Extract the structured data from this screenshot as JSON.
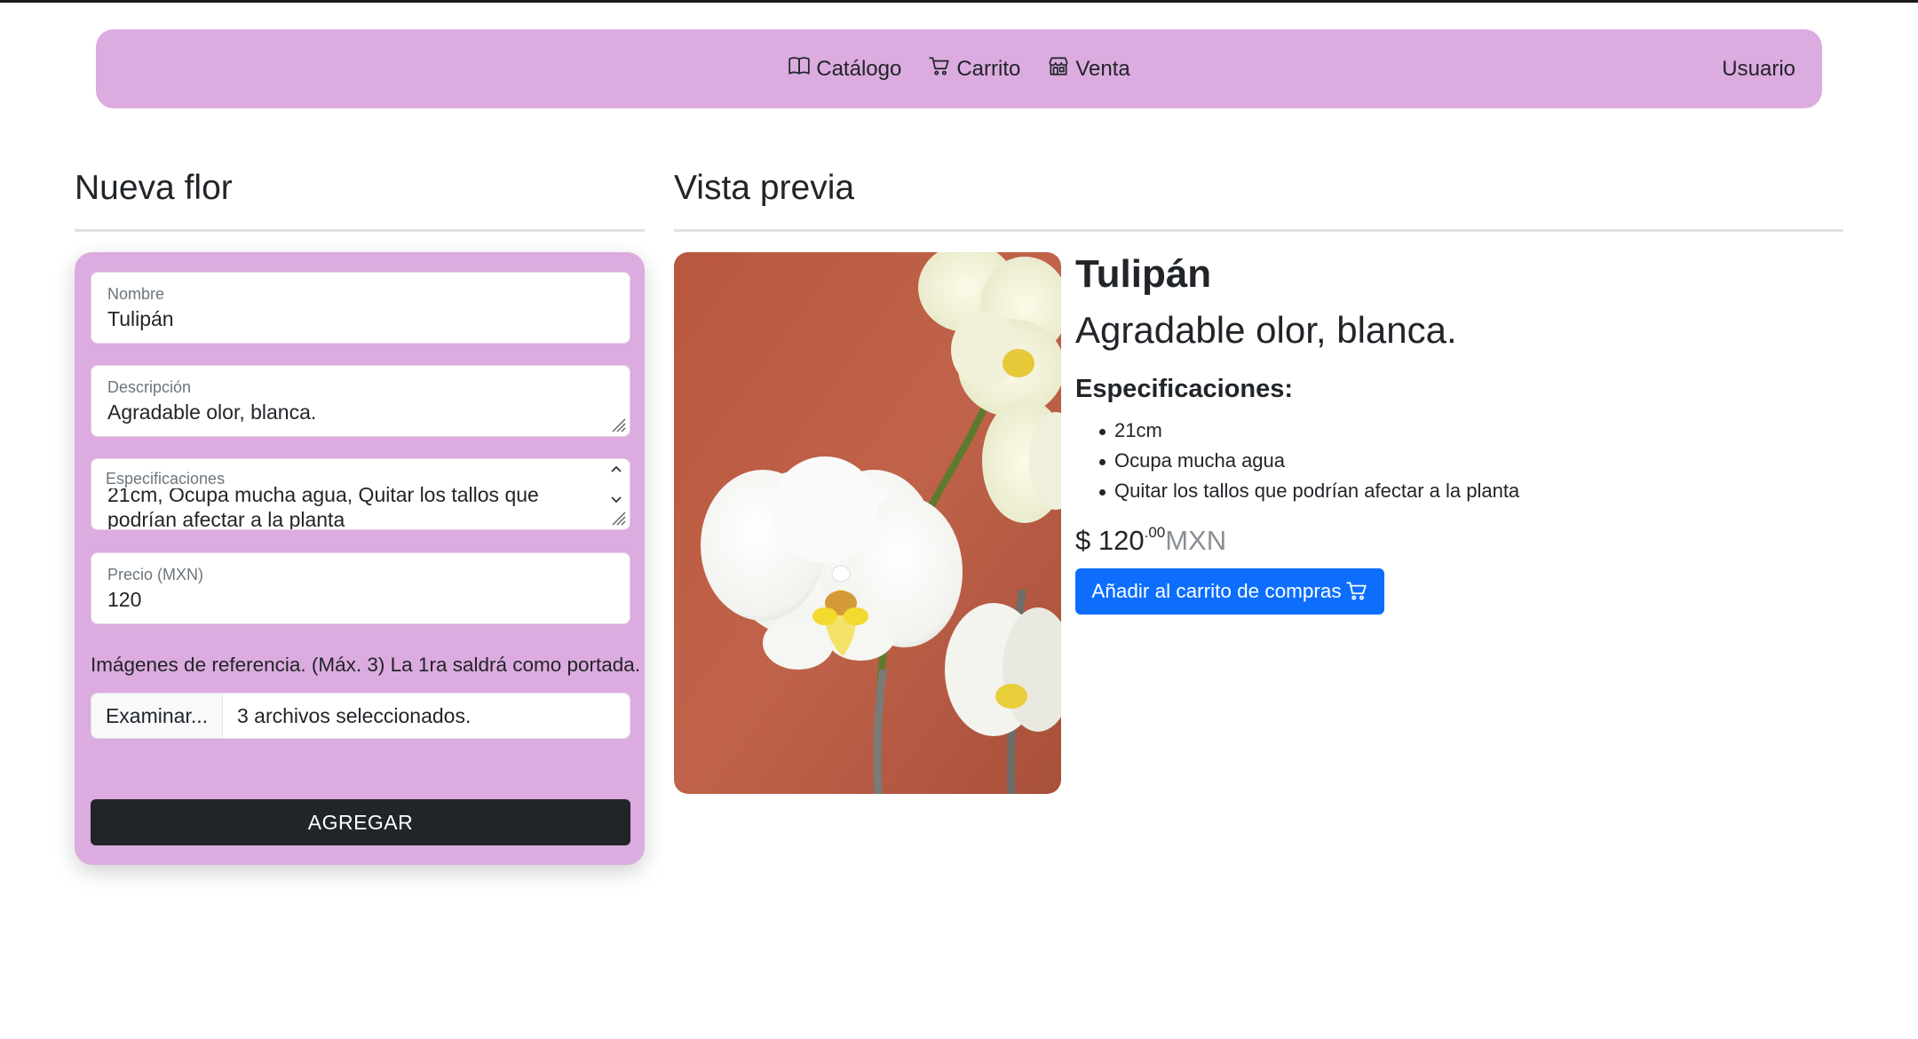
{
  "nav": {
    "catalog": "Catálogo",
    "cart": "Carrito",
    "sale": "Venta",
    "user": "Usuario"
  },
  "form": {
    "heading": "Nueva flor",
    "name_label": "Nombre",
    "name_value": "Tulipán",
    "description_label": "Descripción",
    "description_value": "Agradable olor, blanca.",
    "specs_label": "Especificaciones",
    "specs_value_visible_line1": "21cm, Ocupa mucha agua, Quitar los tallos que",
    "specs_value_visible_line2": "podrían afectar a la planta",
    "price_label": "Precio (MXN)",
    "price_value": "120",
    "images_help": "Imágenes de referencia. (Máx. 3) La 1ra saldrá como portada.",
    "browse_button": "Examinar...",
    "files_selected": "3 archivos seleccionados.",
    "submit": "AGREGAR"
  },
  "preview": {
    "heading": "Vista previa",
    "title": "Tulipán",
    "description": "Agradable olor, blanca.",
    "specs_title": "Especificaciones:",
    "specs": [
      "21cm",
      "Ocupa mucha agua",
      "Quitar los tallos que podrían afectar a la planta"
    ],
    "price_symbol": "$ ",
    "price_int": "120",
    "price_cents": ".00",
    "price_currency": "MXN",
    "add_to_cart": "Añadir al carrito de compras"
  },
  "colors": {
    "accent_pink": "#dcabdf",
    "primary_blue": "#0d6efd",
    "dark_button": "#212529"
  }
}
